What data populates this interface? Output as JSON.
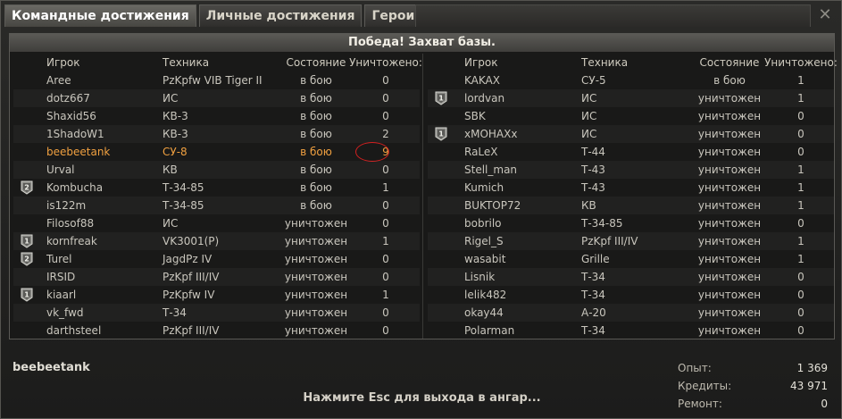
{
  "tabs": [
    "Командные достижения",
    "Личные достижения",
    "Герои битвы"
  ],
  "close_glyph": "✕",
  "banner": "Победа! Захват базы.",
  "headers": {
    "player": "Игрок",
    "vehicle": "Техника",
    "state": "Состояние",
    "kills": "Уничтожено:"
  },
  "left_team": [
    {
      "name": "Aree",
      "vehicle": "PzKpfw VIB Tiger II",
      "state": "в бою",
      "kills": "0",
      "medal": ""
    },
    {
      "name": "dotz667",
      "vehicle": "ИС",
      "state": "в бою",
      "kills": "0",
      "medal": ""
    },
    {
      "name": "Shaxid56",
      "vehicle": "КВ-3",
      "state": "в бою",
      "kills": "0",
      "medal": ""
    },
    {
      "name": "1ShadoW1",
      "vehicle": "КВ-3",
      "state": "в бою",
      "kills": "2",
      "medal": ""
    },
    {
      "name": "beebeetank",
      "vehicle": "СУ-8",
      "state": "в бою",
      "kills": "9",
      "medal": "",
      "self": true
    },
    {
      "name": "Urval",
      "vehicle": "КВ",
      "state": "в бою",
      "kills": "0",
      "medal": ""
    },
    {
      "name": "Kombucha",
      "vehicle": "Т-34-85",
      "state": "в бою",
      "kills": "1",
      "medal": "medal-2-icon"
    },
    {
      "name": "is122m",
      "vehicle": "Т-34-85",
      "state": "в бою",
      "kills": "0",
      "medal": ""
    },
    {
      "name": "Filosof88",
      "vehicle": "ИС",
      "state": "уничтожен",
      "kills": "0",
      "medal": ""
    },
    {
      "name": "kornfreak",
      "vehicle": "VK3001(P)",
      "state": "уничтожен",
      "kills": "1",
      "medal": "medal-1-icon"
    },
    {
      "name": "Turel",
      "vehicle": "JagdPz IV",
      "state": "уничтожен",
      "kills": "0",
      "medal": "medal-2-icon"
    },
    {
      "name": "IRSID",
      "vehicle": "PzKpf III/IV",
      "state": "уничтожен",
      "kills": "0",
      "medal": ""
    },
    {
      "name": "kiaarl",
      "vehicle": "PzKpfw IV",
      "state": "уничтожен",
      "kills": "1",
      "medal": "medal-1-icon"
    },
    {
      "name": "vk_fwd",
      "vehicle": "Т-34",
      "state": "уничтожен",
      "kills": "0",
      "medal": ""
    },
    {
      "name": "darthsteel",
      "vehicle": "PzKpf III/IV",
      "state": "уничтожен",
      "kills": "0",
      "medal": ""
    }
  ],
  "right_team": [
    {
      "name": "KAKAX",
      "vehicle": "СУ-5",
      "state": "в бою",
      "kills": "1",
      "medal": ""
    },
    {
      "name": "lordvan",
      "vehicle": "ИС",
      "state": "уничтожен",
      "kills": "1",
      "medal": "medal-1-icon"
    },
    {
      "name": "SBK",
      "vehicle": "ИС",
      "state": "уничтожен",
      "kills": "0",
      "medal": ""
    },
    {
      "name": "xMOHAXx",
      "vehicle": "ИС",
      "state": "уничтожен",
      "kills": "0",
      "medal": "medal-1-icon"
    },
    {
      "name": "RaLeX",
      "vehicle": "Т-44",
      "state": "уничтожен",
      "kills": "0",
      "medal": ""
    },
    {
      "name": "Stell_man",
      "vehicle": "Т-43",
      "state": "уничтожен",
      "kills": "1",
      "medal": ""
    },
    {
      "name": "Kumich",
      "vehicle": "Т-43",
      "state": "уничтожен",
      "kills": "1",
      "medal": ""
    },
    {
      "name": "BUKTOP72",
      "vehicle": "КВ",
      "state": "уничтожен",
      "kills": "1",
      "medal": ""
    },
    {
      "name": "bobrilo",
      "vehicle": "Т-34-85",
      "state": "уничтожен",
      "kills": "0",
      "medal": ""
    },
    {
      "name": "Rigel_S",
      "vehicle": "PzKpf III/IV",
      "state": "уничтожен",
      "kills": "1",
      "medal": ""
    },
    {
      "name": "wasabit",
      "vehicle": "Grille",
      "state": "уничтожен",
      "kills": "1",
      "medal": ""
    },
    {
      "name": "Lisnik",
      "vehicle": "Т-34",
      "state": "уничтожен",
      "kills": "0",
      "medal": ""
    },
    {
      "name": "lelik482",
      "vehicle": "Т-34",
      "state": "уничтожен",
      "kills": "0",
      "medal": ""
    },
    {
      "name": "okay44",
      "vehicle": "А-20",
      "state": "уничтожен",
      "kills": "0",
      "medal": ""
    },
    {
      "name": "Polarman",
      "vehicle": "Т-34",
      "state": "уничтожен",
      "kills": "0",
      "medal": ""
    }
  ],
  "footer": {
    "player": "beebeetank",
    "hint": "Нажмите Esc для выхода в ангар...",
    "stats": [
      {
        "label": "Опыт:",
        "value": "1 369"
      },
      {
        "label": "Кредиты:",
        "value": "43 971"
      },
      {
        "label": "Ремонт:",
        "value": "0"
      }
    ]
  },
  "colors": {
    "self_highlight": "#f0a040",
    "annotation": "#d42020"
  }
}
